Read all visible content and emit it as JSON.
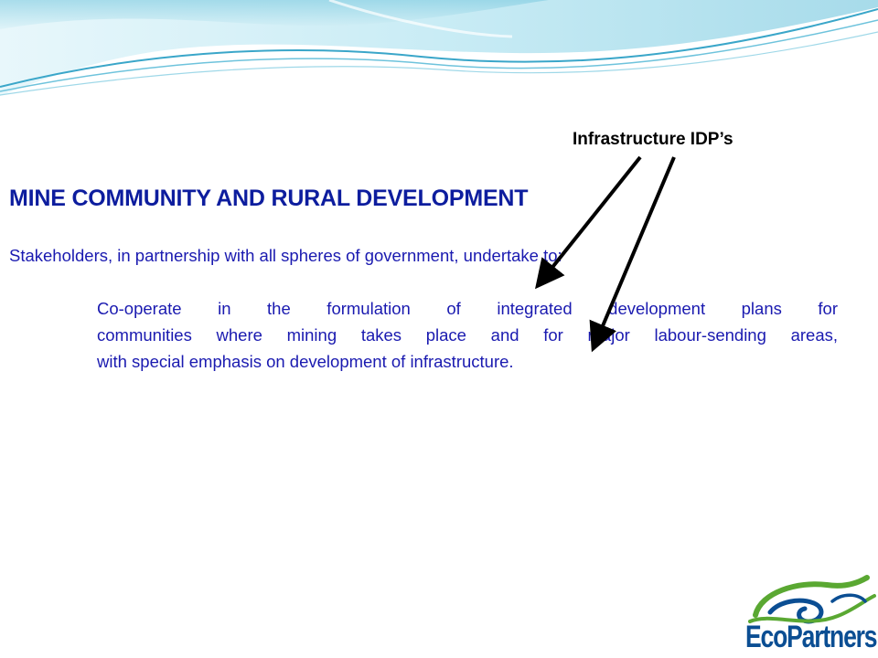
{
  "slide": {
    "callout": "Infrastructure IDP’s",
    "heading": "MINE COMMUNITY AND RURAL DEVELOPMENT",
    "intro": "Stakeholders, in partnership with all spheres of government, undertake to:",
    "body_lines": [
      "Co-operate in the formulation of integrated development plans for",
      "communities where mining takes place and for major labour-sending areas,",
      "with special emphasis on development of infrastructure."
    ]
  },
  "logo": {
    "text": "EcoPartners",
    "icon": "green-blue-swirl-icon"
  },
  "colors": {
    "heading": "#0d1d9e",
    "body": "#1a1ab0",
    "callout": "#000000",
    "wave_light": "#bfe8f2",
    "wave_dark": "#3aa6c9",
    "logo_green": "#5aa832",
    "logo_blue": "#0b4e93"
  }
}
